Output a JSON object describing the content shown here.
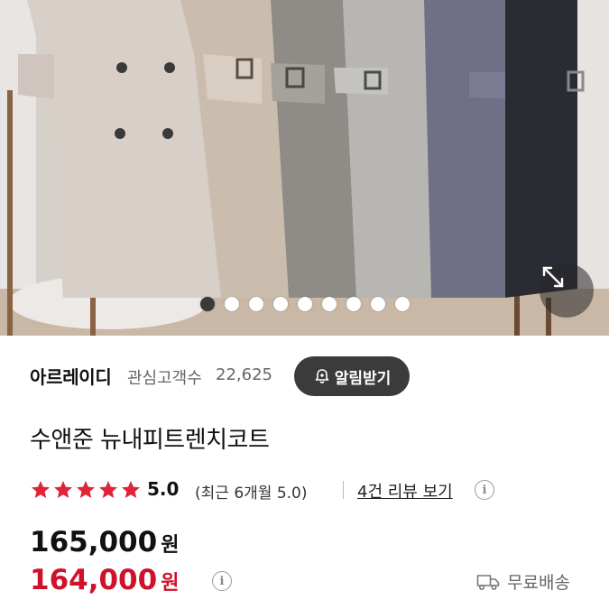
{
  "hero": {
    "image_icon": "trench-coats-photo",
    "carousel": {
      "total": 9,
      "active_index": 0
    },
    "expand_icon": "expand-arrows-icon"
  },
  "store": {
    "name": "아르레이디",
    "favorites_label": "관심고객수",
    "favorites_count": "22,625",
    "alarm_button_label": "알림받기",
    "alarm_icon": "bell-plus-icon"
  },
  "product": {
    "title": "수앤준 뉴내피트렌치코트",
    "rating": {
      "stars": 5,
      "score": "5.0",
      "recent_text": "(최근 6개월 5.0)",
      "review_link": "4건 리뷰 보기"
    },
    "price": {
      "original": "165,000",
      "sale": "164,000",
      "currency": "원",
      "sale_color": "#d0112b"
    },
    "shipping": {
      "icon": "truck-icon",
      "label": "무료배송"
    }
  },
  "colors": {
    "star": "#e0243a",
    "alarm_bg": "#3b3b3b"
  }
}
